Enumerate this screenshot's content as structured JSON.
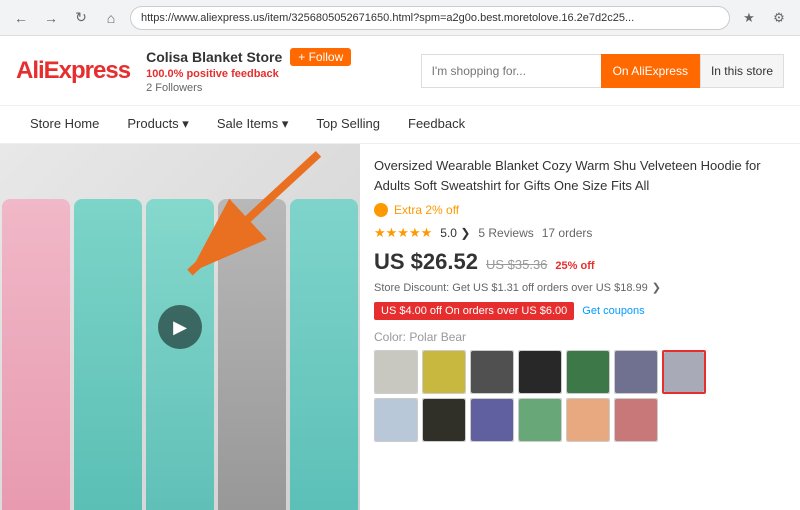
{
  "browser": {
    "url": "https://www.aliexpress.us/item/3256805052671650.html?spm=a2g0o.best.moretolove.16.2e7d2c25...",
    "back_label": "←",
    "refresh_label": "↻",
    "home_label": "⌂",
    "bookmark_label": "☆",
    "settings_label": "⚙"
  },
  "header": {
    "logo": "AliExpress",
    "store_name": "Colisa Blanket Store",
    "positive_feedback": "100.0%",
    "feedback_label": "positive feedback",
    "follow_label": "+ Follow",
    "followers": "2 Followers",
    "search_placeholder": "I'm shopping for...",
    "search_btn_label": "On AliExpress",
    "in_store_btn_label": "In this store"
  },
  "nav": {
    "items": [
      {
        "label": "Store Home"
      },
      {
        "label": "Products ▾"
      },
      {
        "label": "Sale Items ▾"
      },
      {
        "label": "Top Selling"
      },
      {
        "label": "Feedback"
      }
    ]
  },
  "product": {
    "title": "Oversized Wearable Blanket Cozy Warm Shu Velveteen Hoodie for Adults Soft Sweatshirt for Gifts One Size Fits All",
    "extra_discount": "Extra 2% off",
    "rating": "5.0",
    "reviews": "5 Reviews",
    "orders": "17 orders",
    "current_price": "US $26.52",
    "original_price": "US $35.36",
    "discount_pct": "25% off",
    "store_discount": "Store Discount: Get US $1.31 off orders over US $18.99",
    "coupon_label": "US $4.00 off On orders over US $6.00",
    "get_coupons": "Get coupons",
    "color_label": "Color:",
    "selected_color": "Polar Bear",
    "swatches_row1": [
      {
        "color": "#c8c8c0",
        "label": "color1"
      },
      {
        "color": "#c8b840",
        "label": "color2"
      },
      {
        "color": "#505050",
        "label": "color3"
      },
      {
        "color": "#282828",
        "label": "color4"
      },
      {
        "color": "#3c7848",
        "label": "color5"
      },
      {
        "color": "#707090",
        "label": "color6"
      },
      {
        "color": "#a8aab8",
        "label": "color7",
        "selected": true
      }
    ],
    "swatches_row2": [
      {
        "color": "#b8c8d8",
        "label": "color8"
      },
      {
        "color": "#303028",
        "label": "color9"
      },
      {
        "color": "#6060a0",
        "label": "color10"
      },
      {
        "color": "#68a878",
        "label": "color11"
      },
      {
        "color": "#e8a880",
        "label": "color12"
      },
      {
        "color": "#c87878",
        "label": "color13"
      }
    ]
  },
  "icons": {
    "play": "▶",
    "star": "★",
    "chevron": "❯"
  }
}
